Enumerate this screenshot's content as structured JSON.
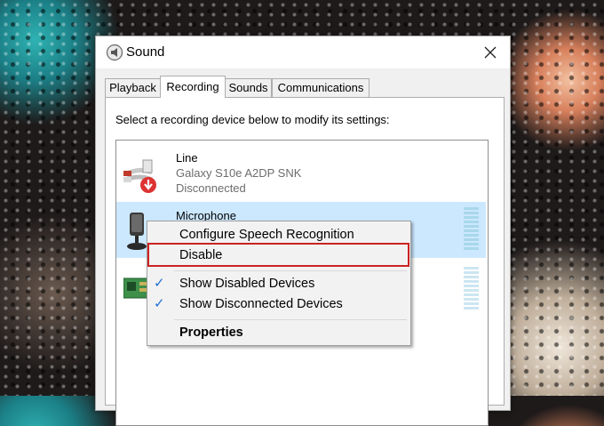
{
  "window": {
    "title": "Sound",
    "close_icon": "close-icon",
    "app_icon": "speaker-icon"
  },
  "tabs": [
    {
      "label": "Playback",
      "active": false
    },
    {
      "label": "Recording",
      "active": true
    },
    {
      "label": "Sounds",
      "active": false
    },
    {
      "label": "Communications",
      "active": false
    }
  ],
  "panel": {
    "instruction": "Select a recording device below to modify its settings:"
  },
  "devices": [
    {
      "name": "Line",
      "description": "Galaxy S10e A2DP SNK",
      "status": "Disconnected",
      "icon": "line-in-jack-icon",
      "status_badge": "disconnected-arrow-icon"
    },
    {
      "name": "Microphone",
      "description": "",
      "status": "",
      "icon": "microphone-icon",
      "selected": true
    },
    {
      "name": "",
      "description": "",
      "status": "",
      "icon": "sound-card-icon"
    }
  ],
  "context_menu": {
    "items": [
      {
        "label": "Configure Speech Recognition",
        "checked": false
      },
      {
        "label": "Disable",
        "checked": false,
        "highlighted": true
      },
      {
        "label": "Show Disabled Devices",
        "checked": true
      },
      {
        "label": "Show Disconnected Devices",
        "checked": true
      },
      {
        "label": "Properties",
        "checked": false,
        "bold": true
      }
    ],
    "check_glyph": "✓"
  },
  "colors": {
    "selection": "#cce8ff",
    "highlight_border": "#cc2222",
    "level_meter": "#a8d8ea",
    "check": "#1f6fd1"
  }
}
